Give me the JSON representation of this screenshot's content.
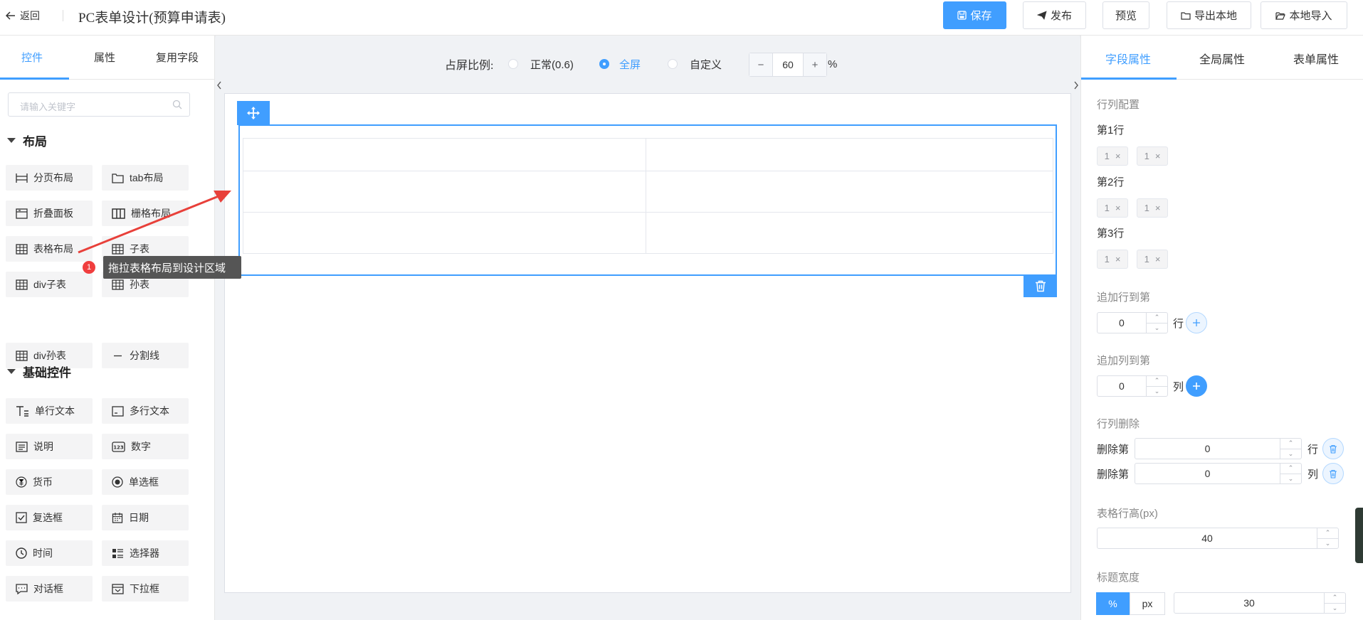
{
  "header": {
    "back_label": "返回",
    "title": "PC表单设计(预算申请表)",
    "buttons": {
      "save": "保存",
      "publish": "发布",
      "preview": "预览",
      "export": "导出本地",
      "import": "本地导入"
    }
  },
  "left_panel": {
    "tabs": [
      "控件",
      "属性",
      "复用字段"
    ],
    "active_tab": "控件",
    "search_placeholder": "请输入关键字",
    "layout_group": {
      "title": "布局",
      "items": [
        "分页布局",
        "tab布局",
        "折叠面板",
        "栅格布局",
        "表格布局",
        "子表",
        "div子表",
        "孙表",
        "div孙表",
        "分割线"
      ]
    },
    "basic_group": {
      "title": "基础控件",
      "items": [
        "单行文本",
        "多行文本",
        "说明",
        "数字",
        "货币",
        "单选框",
        "复选框",
        "日期",
        "时间",
        "选择器",
        "对话框",
        "下拉框"
      ]
    }
  },
  "annotation": {
    "badge": "1",
    "tip": "拖拉表格布局到设计区域"
  },
  "canvas_toolbar": {
    "ratio_label": "占屏比例:",
    "options": [
      "正常(0.6)",
      "全屏",
      "自定义"
    ],
    "selected": "全屏",
    "zoom_minus": "−",
    "zoom_value": "60",
    "zoom_plus": "+",
    "zoom_unit": "%"
  },
  "table_layout": {
    "rows": 3,
    "cols": 2
  },
  "right_panel": {
    "tabs": [
      "字段属性",
      "全局属性",
      "表单属性"
    ],
    "active_tab": "字段属性",
    "row_col_config": {
      "label": "行列配置",
      "rows": [
        {
          "label": "第1行",
          "chips": [
            "1",
            "1"
          ]
        },
        {
          "label": "第2行",
          "chips": [
            "1",
            "1"
          ]
        },
        {
          "label": "第3行",
          "chips": [
            "1",
            "1"
          ]
        }
      ],
      "chip_close": "×"
    },
    "append_row": {
      "label": "追加行到第",
      "value": "0",
      "unit": "行"
    },
    "append_col": {
      "label": "追加列到第",
      "value": "0",
      "unit": "列"
    },
    "delete": {
      "label": "行列删除",
      "row_prefix": "删除第",
      "row_value": "0",
      "row_unit": "行",
      "col_prefix": "删除第",
      "col_value": "0",
      "col_unit": "列"
    },
    "row_height": {
      "label": "表格行高(px)",
      "value": "40"
    },
    "title_width": {
      "label": "标题宽度",
      "unit_percent": "%",
      "unit_px": "px",
      "value": "30"
    }
  },
  "colors": {
    "accent": "#409eff",
    "badge_red": "#f03e3e",
    "arrow_red": "#e8403a"
  }
}
